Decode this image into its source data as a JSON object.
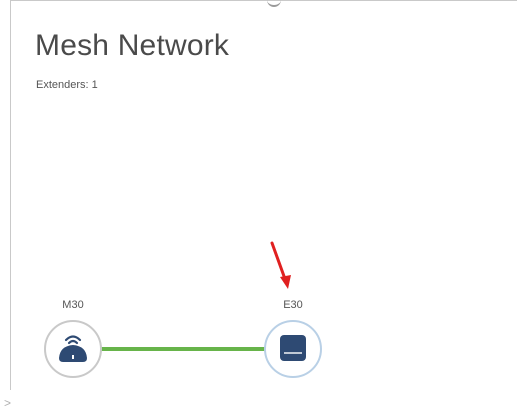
{
  "page": {
    "title": "Mesh Network",
    "extenders_text": "Extenders: 1"
  },
  "nodes": [
    {
      "label": "M30",
      "icon": "router-icon"
    },
    {
      "label": "E30",
      "icon": "extender-icon"
    }
  ],
  "colors": {
    "link": "#67b44a",
    "router_icon": "#2e4a73",
    "extender_icon": "#2e4a73",
    "annotation_arrow": "#e02020"
  }
}
